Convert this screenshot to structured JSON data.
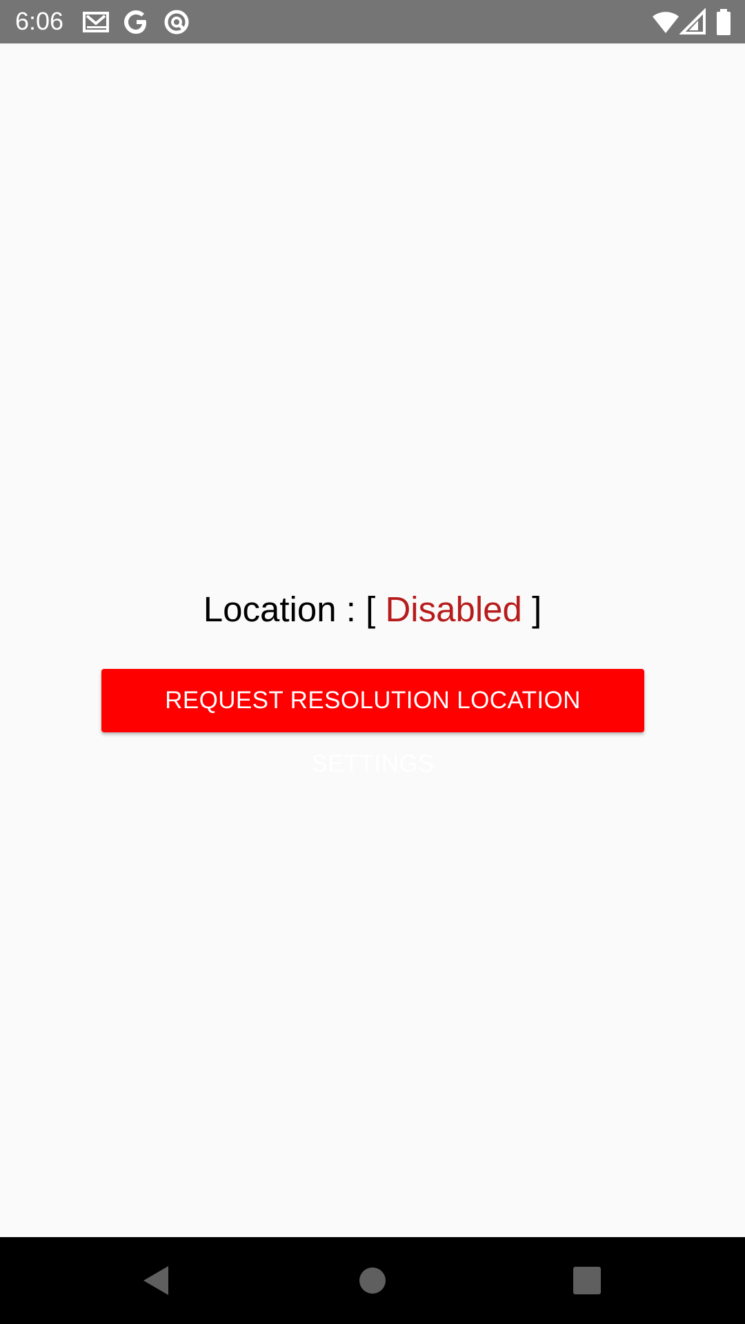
{
  "status_bar": {
    "time": "6:06",
    "left_icons": [
      "gmail-icon",
      "google-g-icon",
      "no-disturb-icon"
    ],
    "right_icons": [
      "wifi-icon",
      "cellular-signal-icon",
      "battery-icon"
    ],
    "background": "#757575"
  },
  "main": {
    "location_label": "Location : [",
    "location_status": "Disabled",
    "location_close": "]",
    "status_color": "#b71c1c",
    "request_button_label": "REQUEST RESOLUTION LOCATION SETTINGS",
    "button_color": "#ff0000"
  },
  "nav_bar": {
    "buttons": [
      "back-icon",
      "home-icon",
      "recents-icon"
    ],
    "background": "#000000"
  }
}
